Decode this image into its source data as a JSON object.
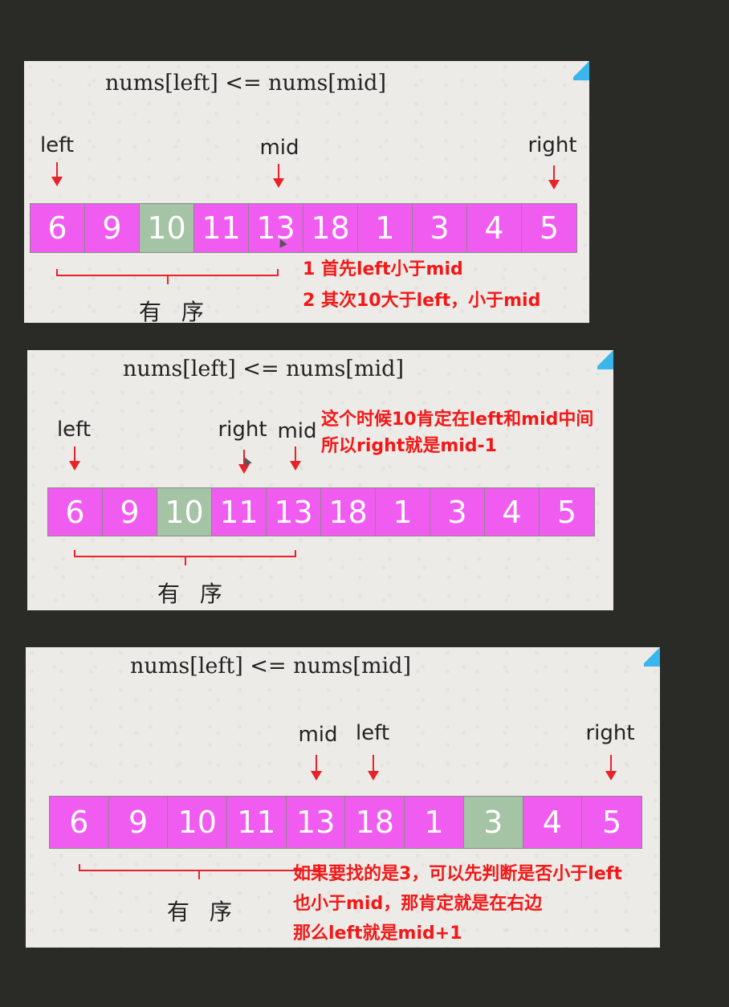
{
  "panels": [
    {
      "title": "nums[left] <= nums[mid]",
      "numbers": [
        "6",
        "9",
        "10",
        "11",
        "13",
        "18",
        "1",
        "3",
        "4",
        "5"
      ],
      "highlight_index": 2,
      "pointers": {
        "left": "left",
        "mid": "mid",
        "right": "right"
      },
      "ordered_label": "有 序",
      "notes": [
        "1 首先left小于mid",
        "2 其次10大于left，小于mid"
      ]
    },
    {
      "title": "nums[left] <= nums[mid]",
      "numbers": [
        "6",
        "9",
        "10",
        "11",
        "13",
        "18",
        "1",
        "3",
        "4",
        "5"
      ],
      "highlight_index": 2,
      "pointers": {
        "left": "left",
        "right": "right",
        "mid": "mid"
      },
      "ordered_label": "有 序",
      "notes": [
        "这个时候10肯定在left和mid中间",
        "所以right就是mid-1"
      ]
    },
    {
      "title": "nums[left] <= nums[mid]",
      "numbers": [
        "6",
        "9",
        "10",
        "11",
        "13",
        "18",
        "1",
        "3",
        "4",
        "5"
      ],
      "highlight_index": 7,
      "pointers": {
        "mid": "mid",
        "left": "left",
        "right": "right"
      },
      "ordered_label": "有 序",
      "notes": [
        "如果要找的是3，可以先判断是否小于left",
        "也小于mid，那肯定就是在右边",
        "那么left就是mid+1"
      ]
    }
  ],
  "colors": {
    "cell": "#f15cf0",
    "highlight": "#a5c3a5",
    "annotation": "#f21818"
  }
}
